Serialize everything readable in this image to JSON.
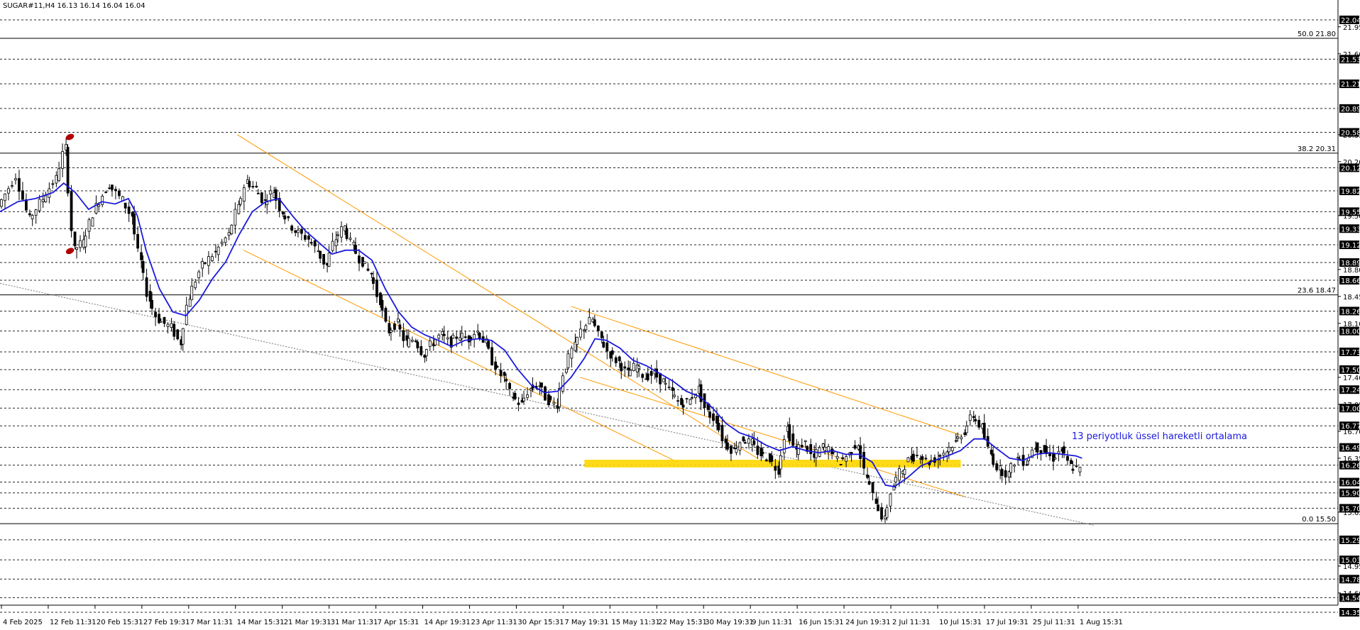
{
  "header": {
    "symbol_line": "SUGAR#11,H4  16.13 16.14 16.04 16.04"
  },
  "chart_data": {
    "type": "candlestick",
    "timeframe": "H4",
    "symbol": "SUGAR#11,H4",
    "ohlc_readout": [
      16.13,
      16.14,
      16.04,
      16.04
    ],
    "ylim": [
      14.22,
      22.14
    ],
    "y_ticks_plain": [
      "21.95",
      "21.60",
      "20.55",
      "20.20",
      "19.50",
      "18.80",
      "18.45",
      "18.10",
      "17.40",
      "17.05",
      "16.70",
      "16.35",
      "15.65",
      "14.95",
      "14.60"
    ],
    "y_ticks_boxed": [
      "22.04",
      "21.53",
      "21.21",
      "20.89",
      "20.58",
      "20.12",
      "19.82",
      "19.55",
      "19.33",
      "19.12",
      "18.89",
      "18.66",
      "18.26",
      "18.00",
      "17.73",
      "17.50",
      "17.24",
      "17.00",
      "16.77",
      "16.49",
      "16.26",
      "16.04",
      "15.90",
      "15.70",
      "15.29",
      "15.03",
      "14.78",
      "14.54",
      "14.35"
    ],
    "horizontal_levels": [
      22.04,
      21.53,
      21.21,
      20.89,
      20.58,
      20.12,
      19.82,
      19.55,
      19.33,
      19.12,
      18.89,
      18.66,
      18.26,
      18.0,
      17.73,
      17.5,
      17.24,
      17.0,
      16.77,
      16.49,
      16.26,
      16.04,
      15.9,
      15.7,
      15.29,
      15.03,
      14.78,
      14.54,
      14.35
    ],
    "fibonacci": [
      {
        "label": "50.0 21.80",
        "value": 21.8
      },
      {
        "label": "38.2 20.31",
        "value": 20.31
      },
      {
        "label": "23.6 18.47",
        "value": 18.47
      },
      {
        "label": "0.0 15.50",
        "value": 15.5
      }
    ],
    "x_labels": [
      "4 Feb 2025",
      "12 Feb 11:31",
      "20 Feb 15:31",
      "27 Feb 19:31",
      "7 Mar 11:31",
      "14 Mar 15:31",
      "21 Mar 19:31",
      "31 Mar 11:31",
      "7 Apr 15:31",
      "14 Apr 19:31",
      "23 Apr 11:31",
      "30 Apr 15:31",
      "7 May 19:31",
      "15 May 11:31",
      "22 May 15:31",
      "30 May 19:31",
      "9 Jun 11:31",
      "16 Jun 15:31",
      "24 Jun 19:31",
      "2 Jul 11:31",
      "10 Jul 15:31",
      "17 Jul 19:31",
      "25 Jul 11:31",
      "1 Aug 15:31"
    ],
    "price_path": [
      [
        0,
        19.62
      ],
      [
        20,
        20.02
      ],
      [
        35,
        19.45
      ],
      [
        50,
        19.72
      ],
      [
        65,
        19.98
      ],
      [
        75,
        20.38
      ],
      [
        85,
        19.05
      ],
      [
        95,
        19.15
      ],
      [
        110,
        19.62
      ],
      [
        125,
        19.9
      ],
      [
        140,
        19.7
      ],
      [
        150,
        19.5
      ],
      [
        160,
        18.9
      ],
      [
        170,
        18.4
      ],
      [
        180,
        18.15
      ],
      [
        195,
        18.05
      ],
      [
        205,
        17.85
      ],
      [
        215,
        18.45
      ],
      [
        230,
        18.85
      ],
      [
        245,
        19.02
      ],
      [
        260,
        19.25
      ],
      [
        270,
        19.6
      ],
      [
        280,
        19.95
      ],
      [
        290,
        19.85
      ],
      [
        300,
        19.68
      ],
      [
        310,
        19.82
      ],
      [
        320,
        19.55
      ],
      [
        335,
        19.3
      ],
      [
        350,
        19.2
      ],
      [
        360,
        19.05
      ],
      [
        370,
        18.85
      ],
      [
        380,
        19.2
      ],
      [
        390,
        19.35
      ],
      [
        400,
        19.1
      ],
      [
        410,
        18.9
      ],
      [
        420,
        18.75
      ],
      [
        430,
        18.4
      ],
      [
        440,
        18.0
      ],
      [
        450,
        18.1
      ],
      [
        460,
        17.85
      ],
      [
        470,
        17.9
      ],
      [
        480,
        17.7
      ],
      [
        490,
        17.85
      ],
      [
        500,
        17.95
      ],
      [
        510,
        17.85
      ],
      [
        520,
        17.95
      ],
      [
        530,
        17.9
      ],
      [
        540,
        18.0
      ],
      [
        550,
        17.85
      ],
      [
        560,
        17.55
      ],
      [
        570,
        17.4
      ],
      [
        580,
        17.15
      ],
      [
        590,
        17.05
      ],
      [
        600,
        17.25
      ],
      [
        610,
        17.3
      ],
      [
        620,
        17.1
      ],
      [
        630,
        17.05
      ],
      [
        640,
        17.55
      ],
      [
        650,
        17.8
      ],
      [
        660,
        18.05
      ],
      [
        670,
        18.15
      ],
      [
        680,
        17.9
      ],
      [
        690,
        17.7
      ],
      [
        700,
        17.6
      ],
      [
        710,
        17.45
      ],
      [
        720,
        17.55
      ],
      [
        730,
        17.4
      ],
      [
        740,
        17.45
      ],
      [
        750,
        17.35
      ],
      [
        760,
        17.2
      ],
      [
        770,
        17.05
      ],
      [
        780,
        17.1
      ],
      [
        790,
        17.25
      ],
      [
        800,
        16.95
      ],
      [
        810,
        16.85
      ],
      [
        820,
        16.55
      ],
      [
        830,
        16.45
      ],
      [
        840,
        16.6
      ],
      [
        850,
        16.55
      ],
      [
        860,
        16.4
      ],
      [
        870,
        16.35
      ],
      [
        880,
        16.2
      ],
      [
        890,
        16.75
      ],
      [
        900,
        16.45
      ],
      [
        910,
        16.55
      ],
      [
        920,
        16.35
      ],
      [
        930,
        16.5
      ],
      [
        940,
        16.45
      ],
      [
        950,
        16.3
      ],
      [
        960,
        16.4
      ],
      [
        970,
        16.55
      ],
      [
        980,
        16.1
      ],
      [
        990,
        15.8
      ],
      [
        1000,
        15.55
      ],
      [
        1010,
        16.0
      ],
      [
        1020,
        16.2
      ],
      [
        1030,
        16.35
      ],
      [
        1040,
        16.4
      ],
      [
        1050,
        16.3
      ],
      [
        1060,
        16.35
      ],
      [
        1070,
        16.45
      ],
      [
        1080,
        16.55
      ],
      [
        1090,
        16.7
      ],
      [
        1100,
        16.9
      ],
      [
        1110,
        16.75
      ],
      [
        1120,
        16.4
      ],
      [
        1130,
        16.2
      ],
      [
        1140,
        16.15
      ],
      [
        1150,
        16.35
      ],
      [
        1160,
        16.3
      ],
      [
        1170,
        16.5
      ],
      [
        1180,
        16.45
      ],
      [
        1190,
        16.35
      ],
      [
        1200,
        16.45
      ],
      [
        1210,
        16.25
      ],
      [
        1220,
        16.2
      ]
    ],
    "ema": {
      "label": "13 periyotluk üssel hareketli ortalama",
      "color": "#1a1adc",
      "path": [
        [
          0,
          19.55
        ],
        [
          20,
          19.68
        ],
        [
          40,
          19.72
        ],
        [
          60,
          19.8
        ],
        [
          72,
          19.92
        ],
        [
          85,
          19.8
        ],
        [
          100,
          19.58
        ],
        [
          115,
          19.68
        ],
        [
          130,
          19.65
        ],
        [
          145,
          19.72
        ],
        [
          155,
          19.5
        ],
        [
          165,
          19.05
        ],
        [
          180,
          18.55
        ],
        [
          195,
          18.25
        ],
        [
          210,
          18.2
        ],
        [
          225,
          18.4
        ],
        [
          240,
          18.68
        ],
        [
          255,
          18.9
        ],
        [
          270,
          19.25
        ],
        [
          285,
          19.55
        ],
        [
          300,
          19.68
        ],
        [
          315,
          19.72
        ],
        [
          330,
          19.5
        ],
        [
          345,
          19.3
        ],
        [
          360,
          19.15
        ],
        [
          375,
          19.0
        ],
        [
          390,
          19.05
        ],
        [
          405,
          19.05
        ],
        [
          420,
          18.92
        ],
        [
          435,
          18.55
        ],
        [
          450,
          18.25
        ],
        [
          465,
          18.05
        ],
        [
          480,
          17.95
        ],
        [
          495,
          17.88
        ],
        [
          510,
          17.8
        ],
        [
          525,
          17.88
        ],
        [
          540,
          17.9
        ],
        [
          555,
          17.88
        ],
        [
          570,
          17.75
        ],
        [
          585,
          17.5
        ],
        [
          600,
          17.3
        ],
        [
          615,
          17.2
        ],
        [
          630,
          17.22
        ],
        [
          645,
          17.4
        ],
        [
          660,
          17.65
        ],
        [
          672,
          17.9
        ],
        [
          685,
          17.88
        ],
        [
          700,
          17.78
        ],
        [
          715,
          17.62
        ],
        [
          730,
          17.55
        ],
        [
          745,
          17.45
        ],
        [
          760,
          17.35
        ],
        [
          775,
          17.22
        ],
        [
          790,
          17.15
        ],
        [
          805,
          17.0
        ],
        [
          820,
          16.8
        ],
        [
          835,
          16.68
        ],
        [
          850,
          16.62
        ],
        [
          865,
          16.52
        ],
        [
          880,
          16.45
        ],
        [
          895,
          16.5
        ],
        [
          910,
          16.45
        ],
        [
          925,
          16.42
        ],
        [
          940,
          16.45
        ],
        [
          955,
          16.4
        ],
        [
          970,
          16.4
        ],
        [
          985,
          16.3
        ],
        [
          1000,
          16.0
        ],
        [
          1010,
          15.98
        ],
        [
          1025,
          16.1
        ],
        [
          1040,
          16.25
        ],
        [
          1055,
          16.32
        ],
        [
          1070,
          16.38
        ],
        [
          1085,
          16.45
        ],
        [
          1100,
          16.6
        ],
        [
          1112,
          16.6
        ],
        [
          1125,
          16.48
        ],
        [
          1140,
          16.35
        ],
        [
          1155,
          16.32
        ],
        [
          1170,
          16.4
        ],
        [
          1185,
          16.42
        ],
        [
          1200,
          16.4
        ],
        [
          1215,
          16.38
        ],
        [
          1222,
          16.35
        ]
      ]
    },
    "annotations": [
      {
        "text": "13 periyotluk üssel hareketli ortalama",
        "color": "#1a1adc"
      }
    ],
    "zone": {
      "from": 16.23,
      "to": 16.33,
      "color": "#ffd700"
    },
    "channel_color": "#ff9900",
    "colors": {
      "candles": "#000000",
      "grid": "#000000",
      "ema": "#1a1adc",
      "zone": "#ffd700",
      "channel": "#ff9900",
      "marker": "#b30000"
    }
  }
}
